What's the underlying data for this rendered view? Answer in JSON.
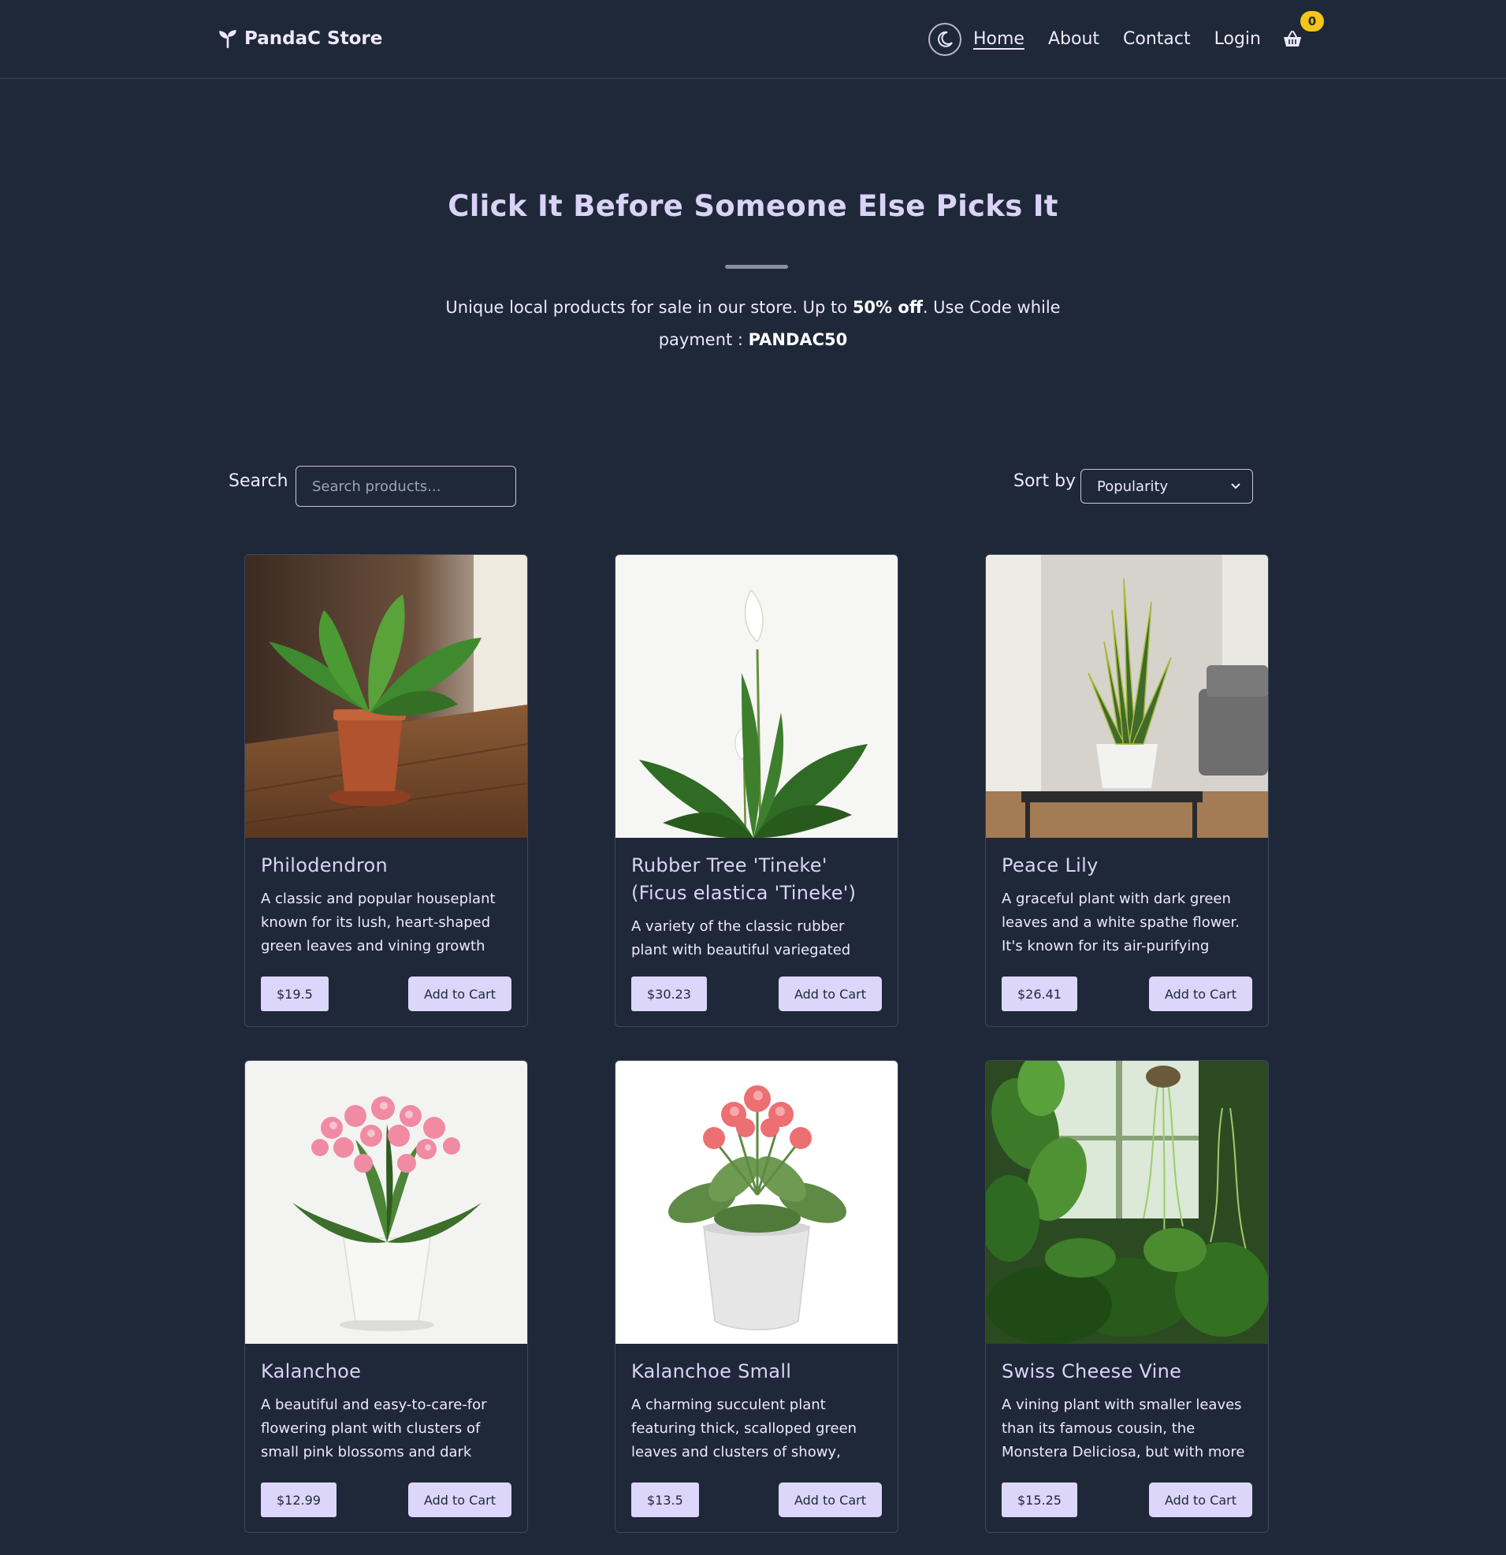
{
  "brand": {
    "name": "PandaC Store",
    "icon": "sprout-icon"
  },
  "nav": {
    "items": [
      {
        "label": "Home",
        "active": true
      },
      {
        "label": "About",
        "active": false
      },
      {
        "label": "Contact",
        "active": false
      },
      {
        "label": "Login",
        "active": false
      }
    ],
    "cart_count": "0",
    "theme_icon": "moon-icon",
    "cart_icon": "basket-icon"
  },
  "hero": {
    "title": "Click It Before Someone Else Picks It",
    "sub_pre": "Unique local products for sale in our store. Up to ",
    "sub_bold": "50% off",
    "sub_mid": ". Use Code while payment : ",
    "code": "PANDAC50"
  },
  "controls": {
    "search_label": "Search",
    "search_placeholder": "Search products...",
    "sort_label": "Sort by",
    "sort_value": "Popularity"
  },
  "products": [
    {
      "title": "Philodendron",
      "desc": "A classic and popular houseplant known for its lush, heart-shaped green leaves and vining growth",
      "price": "$19.5",
      "button": "Add to Cart"
    },
    {
      "title": "Rubber Tree 'Tineke' (Ficus elastica 'Tineke')",
      "desc": "A variety of the classic rubber plant with beautiful variegated",
      "price": "$30.23",
      "button": "Add to Cart"
    },
    {
      "title": "Peace Lily",
      "desc": "A graceful plant with dark green leaves and a white spathe flower. It's known for its air-purifying",
      "price": "$26.41",
      "button": "Add to Cart"
    },
    {
      "title": "Kalanchoe",
      "desc": "A beautiful and easy-to-care-for flowering plant with clusters of small pink blossoms and dark",
      "price": "$12.99",
      "button": "Add to Cart"
    },
    {
      "title": "Kalanchoe Small",
      "desc": "A charming succulent plant featuring thick, scalloped green leaves and clusters of showy,",
      "price": "$13.5",
      "button": "Add to Cart"
    },
    {
      "title": "Swiss Cheese Vine",
      "desc": "A vining plant with smaller leaves than its famous cousin, the Monstera Deliciosa, but with more",
      "price": "$15.25",
      "button": "Add to Cart"
    }
  ]
}
